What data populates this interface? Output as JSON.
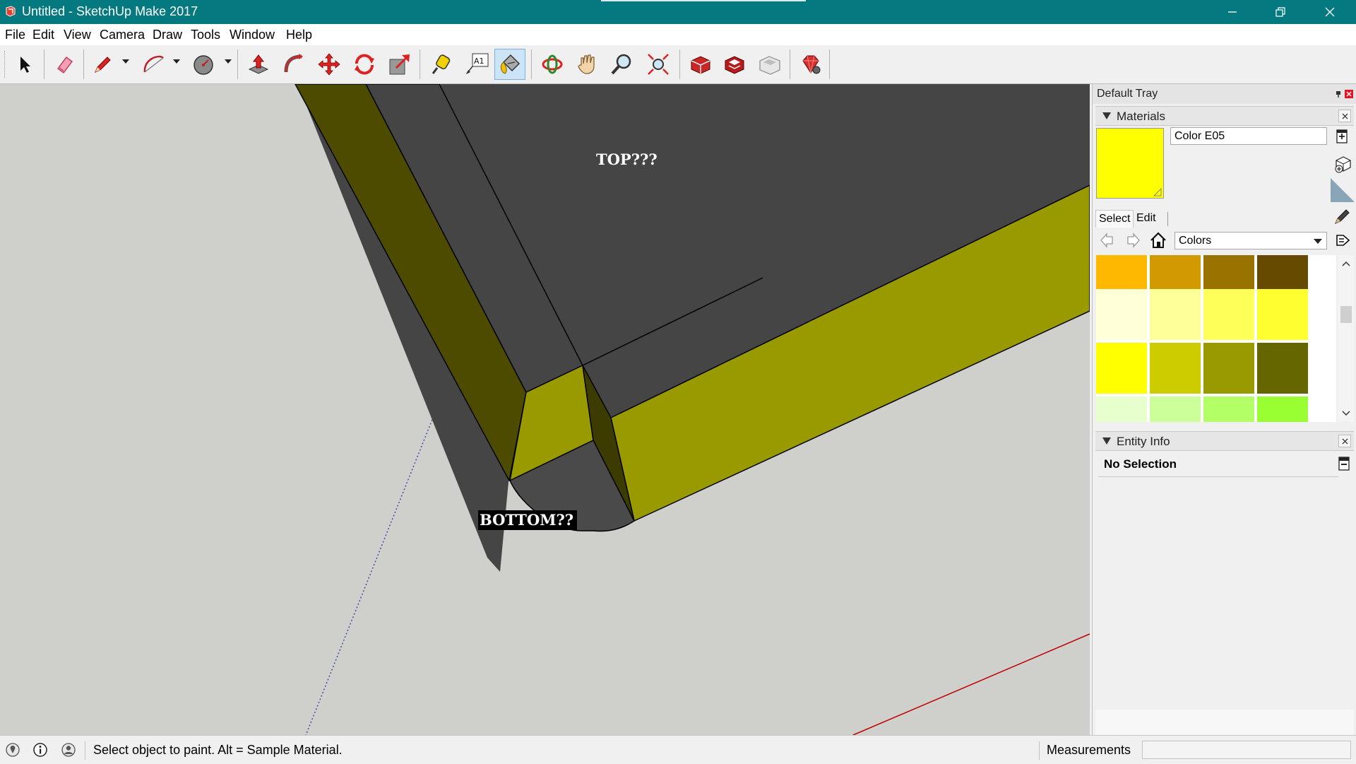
{
  "window": {
    "title": "Untitled - SketchUp Make 2017",
    "accent_color": "#047a80"
  },
  "menu": [
    "File",
    "Edit",
    "View",
    "Camera",
    "Draw",
    "Tools",
    "Window",
    "Help"
  ],
  "toolbar": {
    "tools": [
      "select-icon",
      "eraser-icon",
      "pencil-icon",
      "arc-icon",
      "shapes-icon",
      "push-pull-icon",
      "follow-me-icon",
      "move-icon",
      "rotate-icon",
      "scale-icon",
      "tape-measure-icon",
      "text-icon",
      "paint-bucket-icon",
      "orbit-icon",
      "pan-icon",
      "zoom-icon",
      "zoom-extents-icon",
      "3d-warehouse-icon",
      "extension-warehouse-icon",
      "layout-icon",
      "extension-manager-icon"
    ],
    "active_tool": "paint-bucket-icon",
    "text_tool_glyph": "A1"
  },
  "viewport": {
    "label_top": "TOP???",
    "label_bottom": "BOTTOM??"
  },
  "tray": {
    "title": "Default Tray",
    "materials": {
      "title": "Materials",
      "current_name": "Color E05",
      "current_color": "#ffff00",
      "tabs": [
        "Select",
        "Edit"
      ],
      "active_tab": "Select",
      "library": "Colors",
      "swatches": [
        [
          "#ffb800",
          "#d09a00",
          "#9a7200",
          "#654a00"
        ],
        [
          "#ffffd8",
          "#ffff9a",
          "#ffff5a",
          "#ffff30"
        ],
        [
          "#ffff00",
          "#cccc00",
          "#999900",
          "#666600"
        ],
        [
          "#e6ffcc",
          "#ccff99",
          "#b3ff66",
          "#99ff33"
        ]
      ]
    },
    "entity_info": {
      "title": "Entity Info",
      "selection": "No Selection"
    }
  },
  "status": {
    "message": "Select object to paint. Alt = Sample Material.",
    "measurements_label": "Measurements",
    "measurements_value": ""
  }
}
